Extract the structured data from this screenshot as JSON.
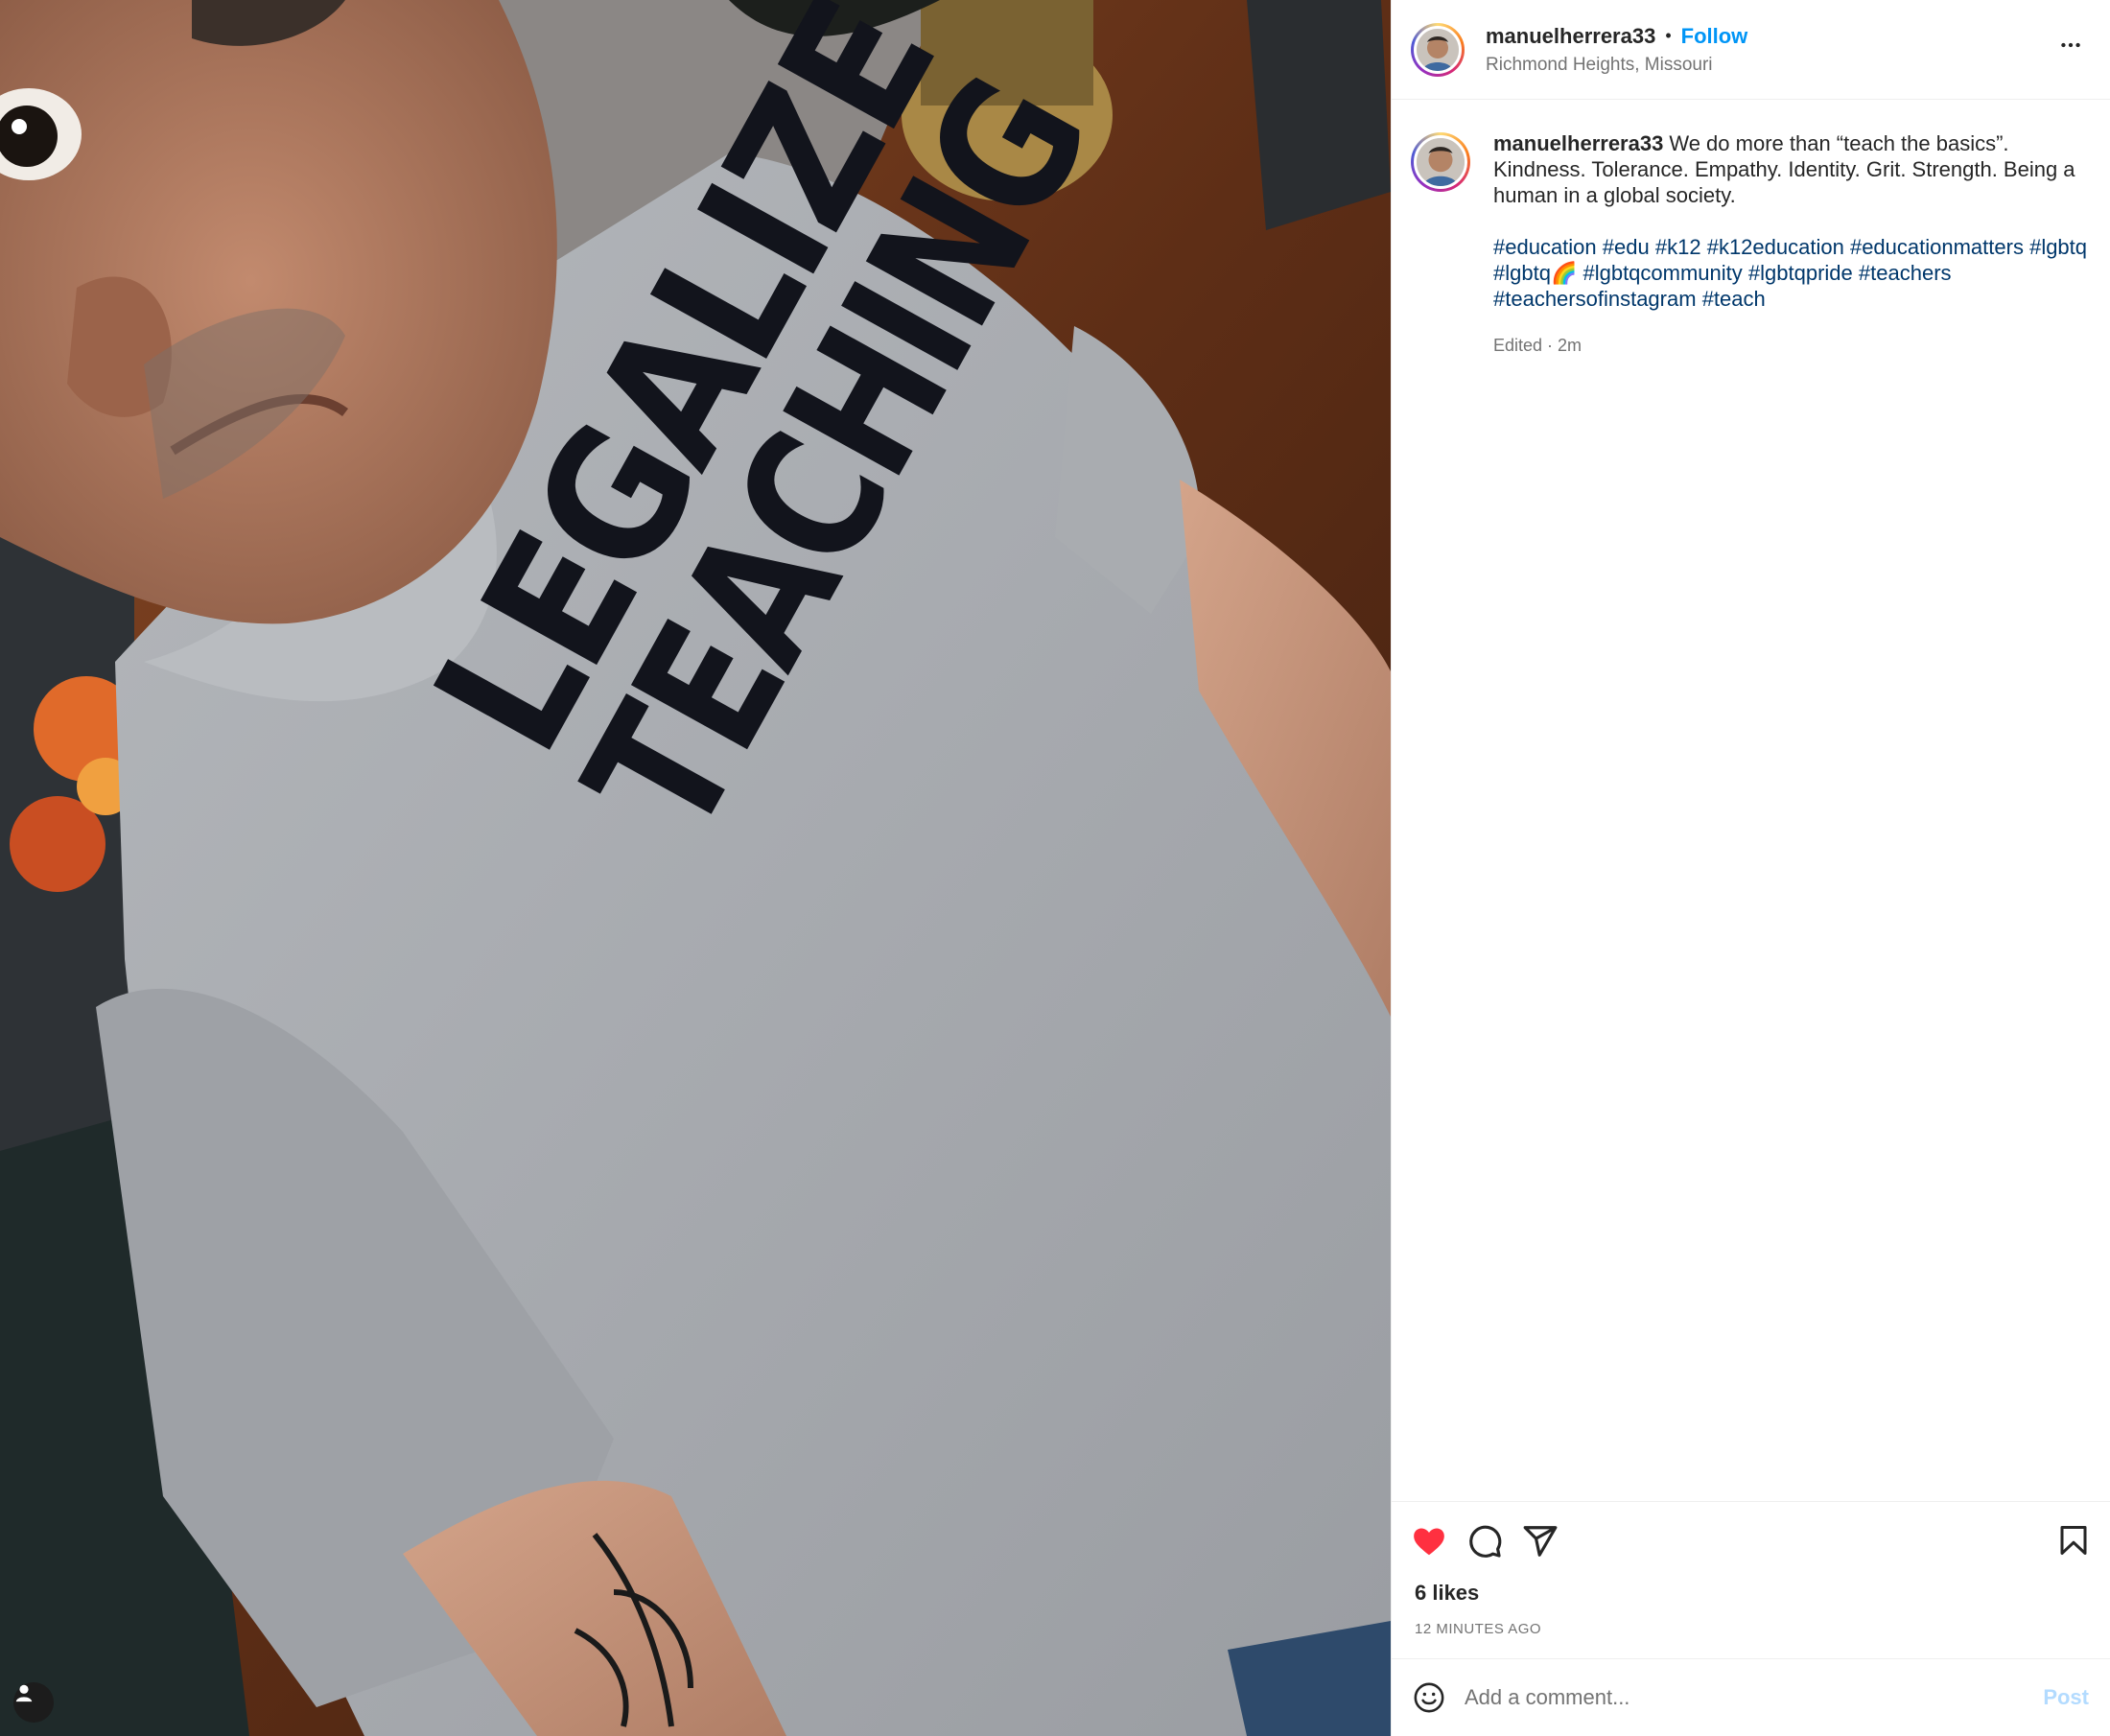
{
  "post": {
    "media": {
      "shirt_line_1": "LEGALIZE",
      "shirt_line_2": "TEACHING",
      "tag_icon": "user-icon"
    },
    "header": {
      "username": "manuelherrera33",
      "separator": "•",
      "follow_label": "Follow",
      "location": "Richmond Heights, Missouri",
      "more_icon": "more-options-icon"
    },
    "caption": {
      "username": "manuelherrera33",
      "text": "We do more than “teach the basics”. Kindness. Tolerance. Empathy. Identity. Grit. Strength. Being a human in a global society.",
      "hashtags": [
        "#education",
        "#edu",
        "#k12",
        "#k12education",
        "#educationmatters",
        "#lgbtq",
        "#lgbtq🌈",
        "#lgbtqcommunity",
        "#lgbtqpride",
        "#teachers",
        "#teachersofinstagram",
        "#teach"
      ],
      "edited": "Edited · 2m"
    },
    "actions": {
      "liked": true,
      "like_color": "#ff3040",
      "icons": [
        "heart-icon",
        "comment-icon",
        "share-icon",
        "bookmark-icon"
      ]
    },
    "likes": "6 likes",
    "timestamp": "12 MINUTES AGO",
    "comment": {
      "placeholder": "Add a comment...",
      "post_label": "Post"
    },
    "colors": {
      "link_blue": "#0095f6",
      "hashtag_blue": "#00376b",
      "muted": "#737373"
    }
  }
}
